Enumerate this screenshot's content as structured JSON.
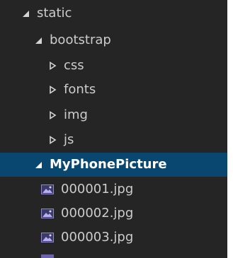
{
  "tree": {
    "static": {
      "label": "static"
    },
    "bootstrap": {
      "label": "bootstrap"
    },
    "css": {
      "label": "css"
    },
    "fonts": {
      "label": "fonts"
    },
    "img": {
      "label": "img"
    },
    "js": {
      "label": "js"
    },
    "my_phone_picture": {
      "label": "MyPhonePicture"
    },
    "files": [
      {
        "label": "000001.jpg"
      },
      {
        "label": "000002.jpg"
      },
      {
        "label": "000003.jpg"
      }
    ]
  },
  "colors": {
    "background": "#252526",
    "selection": "#094771",
    "text": "#cccccc",
    "image_icon": "#6b63a8"
  },
  "icons": {
    "expanded": "chevron-down-icon",
    "collapsed": "chevron-right-icon",
    "image_file": "image-file-icon"
  }
}
